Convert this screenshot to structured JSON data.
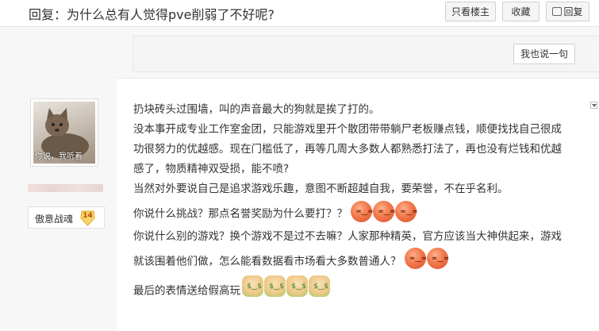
{
  "header": {
    "title": "回复：为什么总有人觉得pve削弱了不好呢?",
    "only_op_label": "只看楼主",
    "favorite_label": "收藏",
    "reply_label": "回复",
    "reply_icon": "comment-icon"
  },
  "reply_box": {
    "say_button_label": "我也说一句"
  },
  "author": {
    "avatar_caption": "你说，我听着",
    "badge_name": "傲意战魂",
    "level": "14"
  },
  "post": {
    "lines": [
      "扔块砖头过围墙，叫的声音最大的狗就是挨了打的。",
      "没本事开成专业工作室金团，只能游戏里开个散团带带躺尸老板赚点钱，顺便找找自己很成",
      "功很努力的优越感。现在门槛低了，再等几周大多数人都熟悉打法了，再也没有烂钱和优越",
      "感了，物质精神双受损，能不喷?",
      "当然对外要说自己是追求游戏乐趣，意图不断超越自我，要荣誉，不在乎名利。",
      "你说什么挑战？那点名誉奖励为什么要打？？",
      "你说什么别的游戏？换个游戏不是过不去嘛？人家那种精英，官方应该当大神供起来，游戏",
      "就该围着他们做，怎么能看数据看市场看大多数普通人？",
      "最后的表情送给假高玩"
    ]
  },
  "colors": {
    "accent_red_emoji": "#f2784b",
    "level_badge": "#f5c242"
  }
}
